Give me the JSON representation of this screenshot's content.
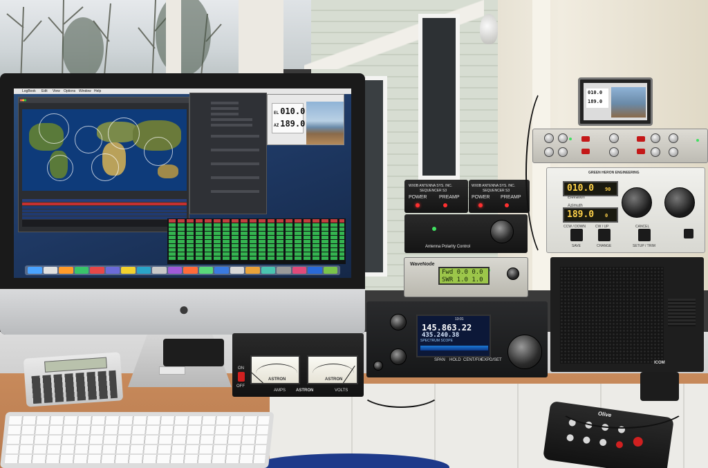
{
  "screen": {
    "menu_items": [
      "LogBook",
      "Edit",
      "View",
      "Options",
      "Window",
      "Help"
    ],
    "rotor_el_label": "EL",
    "rotor_el_value": "010.0",
    "rotor_az_label": "AZ",
    "rotor_az_value": "189.0"
  },
  "preamps": {
    "left_brand": "WX0B ANTENNA SYS. INC.",
    "left_model": "SEQUENCER S3",
    "left_power": "POWER",
    "left_preamp": "PREAMP",
    "right_brand": "WX0B ANTENNA SYS. INC.",
    "right_model": "SEQUENCER S3",
    "right_power": "POWER",
    "right_preamp": "PREAMP",
    "polarity_label": "Antenna Polarity Control"
  },
  "wavenode": {
    "brand": "WaveNode",
    "lcd_line1": "Fwd  0.0  0.0",
    "lcd_line2": "SWR  1.0  1.0"
  },
  "rotor_controller": {
    "brand": "GREEN HERON ENGINEERING",
    "el_readout": "010.0",
    "el_setpoint": "90",
    "elevation_label": "Elevation",
    "az_readout": "189.0",
    "az_setpoint": "0",
    "azimuth_label": "Azimuth",
    "btn_ccw": "CCW / DOWN",
    "btn_cw": "CW / UP",
    "btn_cancel": "CANCEL",
    "btn_save": "SAVE",
    "btn_change": "CHANGE",
    "btn_setup": "SETUP / TRIM"
  },
  "radio": {
    "vfo_a": "145.863.22",
    "vfo_b": "435.240.38",
    "clock": "13:01",
    "keys": [
      "SPAN",
      "HOLD",
      "CENT/FIX",
      "EXPD/SET"
    ],
    "spectrum_label": "SPECTRUM SCOPE"
  },
  "speaker": {
    "brand": "ICOM"
  },
  "power_supply": {
    "brand": "ASTRON",
    "amps_label": "AMPS",
    "volts_label": "VOLTS",
    "on_label": "ON",
    "off_label": "OFF",
    "meter_left_brand": "ASTRON",
    "meter_right_brand": "ASTRON"
  },
  "remote": {
    "brand": "Olive"
  },
  "colors": {
    "led_red": "#ff3030",
    "led_green": "#40e060",
    "lcd_amber": "#ffd24a",
    "lcd_green": "#9cc64a"
  }
}
